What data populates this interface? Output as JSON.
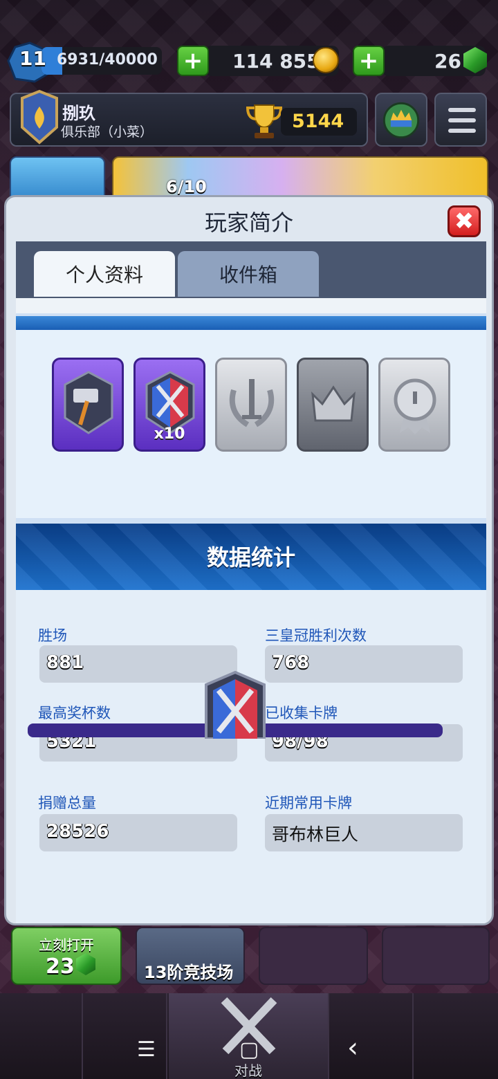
{
  "top_bar": {
    "level": "11",
    "xp_text": "6931/40000",
    "xp_progress": 0.173,
    "gold": "114 855",
    "gems": "26",
    "add_label": "+"
  },
  "profile_row": {
    "player_name": "捌玖",
    "clan": "俱乐部（小菜）",
    "trophies": "5144"
  },
  "background_banner": {
    "progress": "6/10"
  },
  "modal": {
    "title": "玩家简介",
    "close_label": "✖",
    "tabs": [
      {
        "label": "个人资料",
        "active": true
      },
      {
        "label": "收件箱",
        "active": false
      }
    ],
    "badges": [
      {
        "name": "hammer-badge",
        "style": "purple"
      },
      {
        "name": "crossed-swords-badge",
        "style": "purple",
        "label": "x10"
      },
      {
        "name": "sword-laurel-badge",
        "style": "silver"
      },
      {
        "name": "crown-badge",
        "style": "dark-silver"
      },
      {
        "name": "medal-badge",
        "style": "silver"
      }
    ],
    "stats_title": "数据统计",
    "stats": [
      {
        "label": "胜场",
        "value": "881"
      },
      {
        "label": "三皇冠胜利次数",
        "value": "768"
      },
      {
        "label": "最高奖杯数",
        "value": "5321"
      },
      {
        "label": "已收集卡牌",
        "value": "98/98"
      },
      {
        "label": "捐赠总量",
        "value": "28526"
      },
      {
        "label": "近期常用卡牌",
        "value": "哥布林巨人"
      }
    ]
  },
  "chests": [
    {
      "top": "立刻打开",
      "cost": "23"
    },
    {
      "label": "13阶竞技场"
    }
  ],
  "bottom_nav": {
    "battle_label": "对战"
  },
  "system_nav": {
    "menu": "☰",
    "home": "▢",
    "back": "‹"
  },
  "colors": {
    "accent_blue": "#1f56b8",
    "gold": "#ffd64a",
    "close_red": "#d31e1e"
  }
}
